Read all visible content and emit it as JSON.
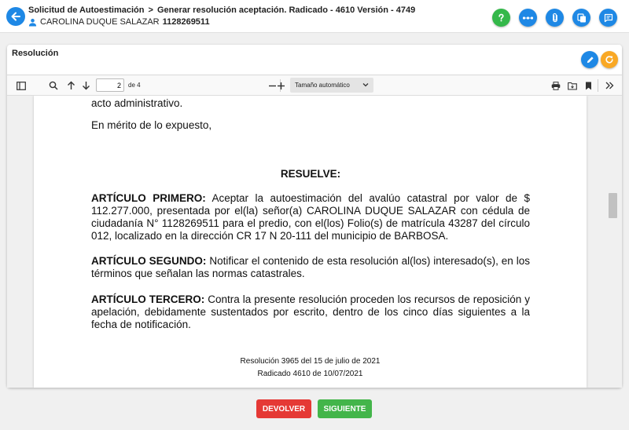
{
  "header": {
    "breadcrumb": [
      "Solicitud de Autoestimación",
      "Generar resolución aceptación. Radicado - 4610 Versión - 4749"
    ],
    "breadcrumb_sep": ">",
    "user_name": "CAROLINA DUQUE SALAZAR",
    "user_id": "1128269511",
    "icons": [
      "help-icon",
      "more-icon",
      "attachment-icon",
      "copy-icon",
      "notes-icon"
    ]
  },
  "card": {
    "title": "Resolución"
  },
  "viewer": {
    "page_current": "2",
    "page_total_label": "de 4",
    "zoom_label": "Tamaño automático"
  },
  "document": {
    "p1": "acto administrativo.",
    "p2": "En mérito de lo expuesto,",
    "resuelve": "RESUELVE:",
    "art1_head": "ARTÍCULO PRIMERO:",
    "art1_body": " Aceptar la autoestimación del avalúo catastral por valor de $ 112.277.000, presentada por el(la) señor(a) CAROLINA DUQUE SALAZAR con cédula de ciudadanía N° 1128269511 para el predio, con el(los) Folio(s) de matrícula 43287 del círculo 012, localizado en la dirección CR 17 N 20-111 del municipio de BARBOSA.",
    "art2_head": "ARTÍCULO SEGUNDO:",
    "art2_body": " Notificar el contenido de esta resolución al(los) interesado(s), en los términos que señalan las normas catastrales.",
    "art3_head": "ARTÍCULO TERCERO:",
    "art3_body": " Contra la presente resolución proceden los recursos de reposición y apelación, debidamente sustentados por escrito, dentro de los cinco días siguientes a la fecha de notificación.",
    "footer1": "Resolución 3965 del 15 de julio de 2021",
    "footer2": "Radicado 4610 de 10/07/2021"
  },
  "actions": {
    "return_label": "DEVOLVER",
    "next_label": "SIGUIENTE"
  },
  "colors": {
    "primary": "#1e88e5",
    "help": "#34b84a",
    "refresh": "#f9a825",
    "danger": "#e53935",
    "success": "#43b54a"
  }
}
